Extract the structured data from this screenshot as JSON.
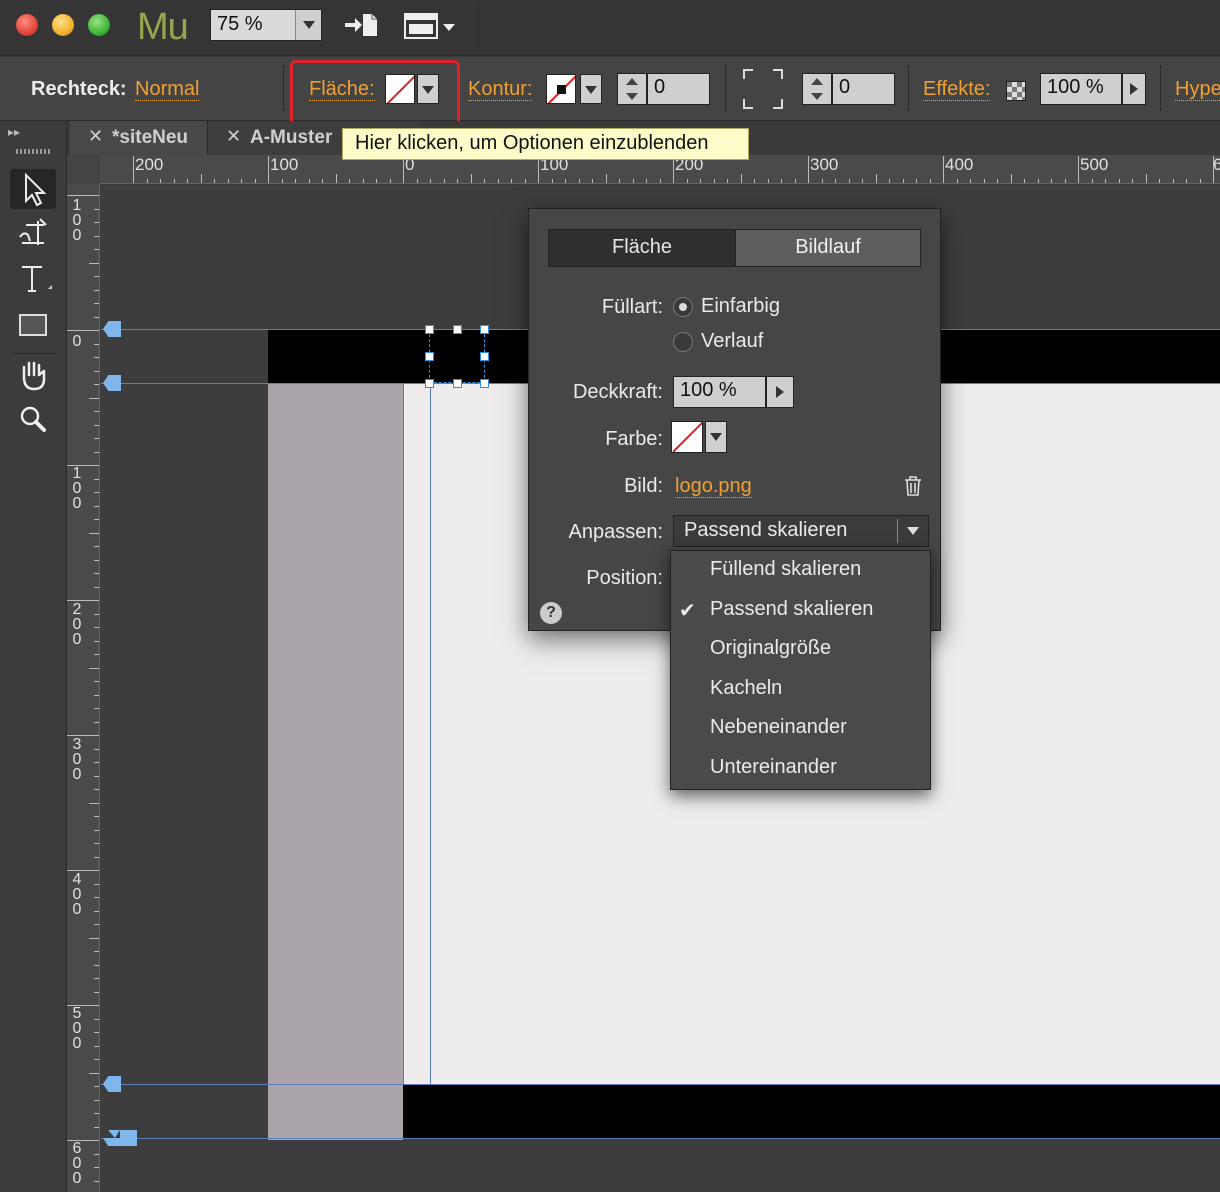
{
  "app": {
    "logo": "Mu",
    "zoom": "75 %"
  },
  "toolbar": {
    "object_label": "Rechteck:",
    "object_state": "Normal",
    "fill_label": "Fläche:",
    "stroke_label": "Kontur:",
    "stroke_value": "0",
    "corner_value": "0",
    "effects_label": "Effekte:",
    "opacity_value": "100 %",
    "hyperlinks_label": "Hype"
  },
  "tooltip": "Hier klicken, um Optionen einzublenden",
  "tabs": [
    {
      "label": "*siteNeu"
    },
    {
      "label": "A-Muster"
    }
  ],
  "ruler_h": [
    "200",
    "100",
    "0",
    "100",
    "200",
    "300",
    "400",
    "500",
    "6"
  ],
  "ruler_v": [
    "100",
    "0",
    "100",
    "200",
    "300",
    "400",
    "500",
    "600"
  ],
  "panel": {
    "tab_fill": "Fläche",
    "tab_scroll": "Bildlauf",
    "fill_type_label": "Füllart:",
    "fill_solid": "Einfarbig",
    "fill_gradient": "Verlauf",
    "opacity_label": "Deckkraft:",
    "opacity_value": "100 %",
    "color_label": "Farbe:",
    "image_label": "Bild:",
    "image_file": "logo.png",
    "fit_label": "Anpassen:",
    "fit_value": "Passend skalieren",
    "position_label": "Position:",
    "help": "?"
  },
  "dropdown": {
    "items": [
      "Füllend skalieren",
      "Passend skalieren",
      "Originalgröße",
      "Kacheln",
      "Nebeneinander",
      "Untereinander"
    ],
    "checked": "✔"
  },
  "colors": {
    "accent_orange": "#f0a030",
    "highlight_red": "#e0202a",
    "guide_blue": "#5a7fc0",
    "logo_green": "#9aa44f"
  }
}
